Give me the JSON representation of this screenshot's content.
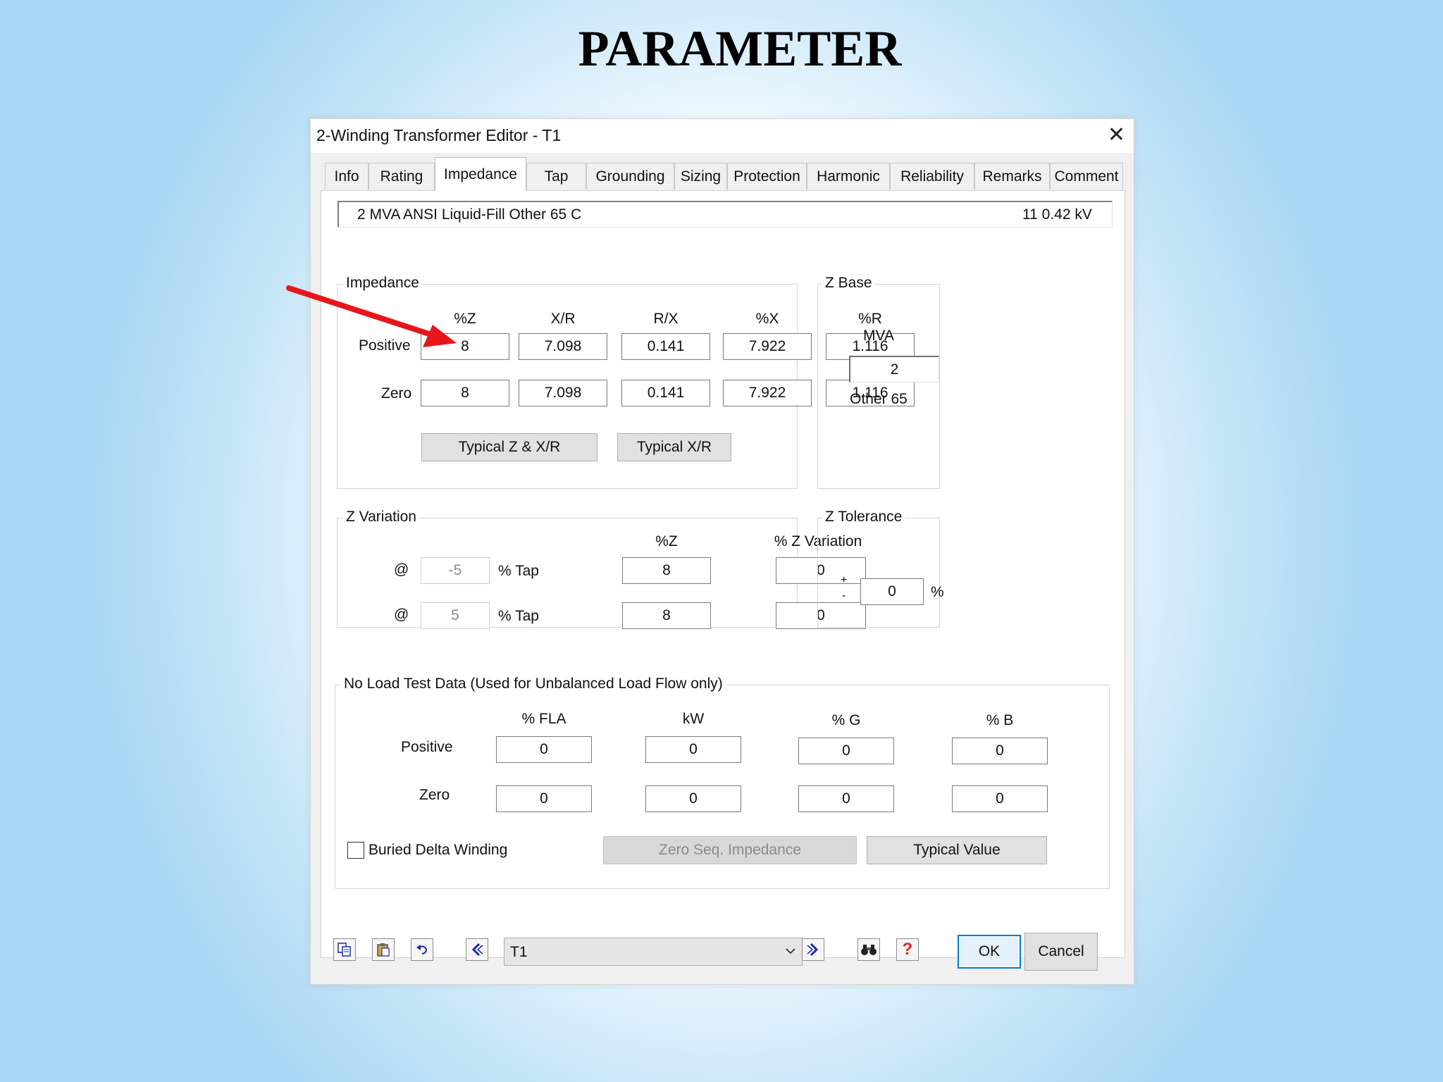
{
  "slide": {
    "title": "PARAMETER"
  },
  "window": {
    "title": "2-Winding Transformer Editor - T1",
    "close": "✕"
  },
  "tabs": [
    {
      "label": "Info"
    },
    {
      "label": "Rating"
    },
    {
      "label": "Impedance",
      "active": true
    },
    {
      "label": "Tap"
    },
    {
      "label": "Grounding"
    },
    {
      "label": "Sizing"
    },
    {
      "label": "Protection"
    },
    {
      "label": "Harmonic"
    },
    {
      "label": "Reliability"
    },
    {
      "label": "Remarks"
    },
    {
      "label": "Comment"
    }
  ],
  "infobar": {
    "description": "2 MVA  ANSI  Liquid-Fill  Other  65 C",
    "voltage": "11    0.42 kV"
  },
  "impedance": {
    "group_label": "Impedance",
    "columns": [
      "%Z",
      "X/R",
      "R/X",
      "%X",
      "%R"
    ],
    "positive": {
      "label": "Positive",
      "values": [
        "8",
        "7.098",
        "0.141",
        "7.922",
        "1.116"
      ]
    },
    "zero": {
      "label": "Zero",
      "values": [
        "8",
        "7.098",
        "0.141",
        "7.922",
        "1.116"
      ]
    },
    "btn_typical_z_xr": "Typical Z & X/R",
    "btn_typical_xr": "Typical  X/R"
  },
  "zbase": {
    "group_label": "Z Base",
    "mva_label": "MVA",
    "mva_value": "2",
    "note": "Other 65"
  },
  "zvariation": {
    "group_label": "Z Variation",
    "col_z": "%Z",
    "col_var": "% Z Variation",
    "rows": [
      {
        "at": "@",
        "tap": "-5",
        "tap_label": "% Tap",
        "z": "8",
        "var": "0"
      },
      {
        "at": "@",
        "tap": "5",
        "tap_label": "% Tap",
        "z": "8",
        "var": "0"
      }
    ]
  },
  "ztolerance": {
    "group_label": "Z Tolerance",
    "plus": "+",
    "minus": "-",
    "value": "0",
    "unit": "%"
  },
  "noload": {
    "group_label": "No Load Test Data (Used for Unbalanced Load Flow only)",
    "columns": [
      "% FLA",
      "kW",
      "% G",
      "% B"
    ],
    "positive": {
      "label": "Positive",
      "values": [
        "0",
        "0",
        "0",
        "0"
      ]
    },
    "zero": {
      "label": "Zero",
      "values": [
        "0",
        "0",
        "0",
        "0"
      ]
    },
    "buried_delta": "Buried Delta Winding",
    "btn_zero_seq": "Zero Seq. Impedance",
    "btn_typical_value": "Typical Value"
  },
  "bottom": {
    "element": "T1",
    "ok": "OK",
    "cancel": "Cancel",
    "help": "?"
  },
  "colors": {
    "arrow": "#e8161b",
    "ok_border": "#0078d7",
    "help_icon": "#e02020",
    "nav_icon": "#1a2aa8"
  }
}
